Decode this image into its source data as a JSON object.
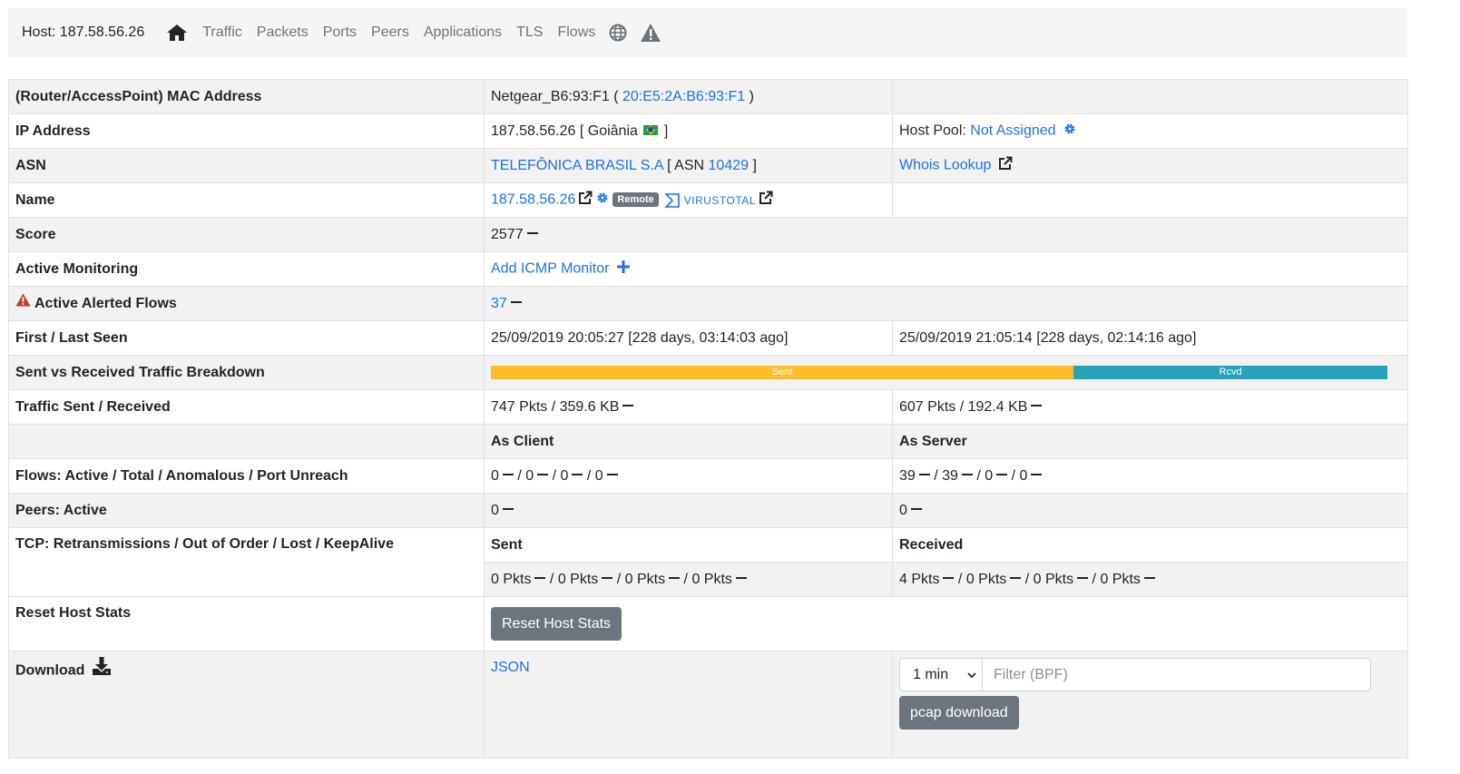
{
  "nav": {
    "host": "Host: 187.58.56.26",
    "items": [
      "Traffic",
      "Packets",
      "Ports",
      "Peers",
      "Applications",
      "TLS",
      "Flows"
    ]
  },
  "colors": {
    "link": "#1a73e8",
    "sent": "#fbbd2c",
    "rcvd": "#27a2b8",
    "button": "#6c757d",
    "alert": "#c0392b"
  },
  "rows": {
    "mac": {
      "label": "(Router/AccessPoint) MAC Address",
      "vendor": "Netgear_B6:93:F1 (",
      "mac": "20:E5:2A:B6:93:F1",
      "close": ")"
    },
    "ip": {
      "label": "IP Address",
      "value": "187.58.56.26 [ Goiânia",
      "close": "]",
      "pool_label": "Host Pool:",
      "pool_value": "Not Assigned"
    },
    "asn": {
      "label": "ASN",
      "org": "TELEFÔNICA BRASIL S.A",
      "asn_prefix": "[ ASN",
      "asn": "10429",
      "close": "]",
      "whois": "Whois Lookup"
    },
    "name": {
      "label": "Name",
      "value": "187.58.56.26",
      "badge": "Remote",
      "virustotal": "VIRUSTOTAL"
    },
    "score": {
      "label": "Score",
      "value": "2577"
    },
    "monitoring": {
      "label": "Active Monitoring",
      "link": "Add ICMP Monitor"
    },
    "alerted": {
      "label": "Active Alerted Flows",
      "value": "37"
    },
    "seen": {
      "label": "First / Last Seen",
      "first": "25/09/2019 20:05:27 [228 days, 03:14:03 ago]",
      "last": "25/09/2019 21:05:14 [228 days, 02:14:16 ago]"
    },
    "breakdown": {
      "label": "Sent vs Received Traffic Breakdown",
      "sent_label": "Sent",
      "rcvd_label": "Rcvd",
      "sent_pct": 65
    },
    "traffic": {
      "label": "Traffic Sent / Received",
      "sent": "747 Pkts / 359.6 KB",
      "received": "607 Pkts / 192.4 KB"
    },
    "roles": {
      "client": "As Client",
      "server": "As Server"
    },
    "flows": {
      "label": "Flows: Active / Total / Anomalous / Port Unreach",
      "client": [
        "0",
        "0",
        "0",
        "0"
      ],
      "server": [
        "39",
        "39",
        "0",
        "0"
      ]
    },
    "peers": {
      "label": "Peers: Active",
      "client": "0",
      "server": "0"
    },
    "tcp": {
      "label": "TCP: Retransmissions / Out of Order / Lost / KeepAlive",
      "sent_header": "Sent",
      "received_header": "Received",
      "sent": [
        "0 Pkts",
        "0 Pkts",
        "0 Pkts",
        "0 Pkts"
      ],
      "received": [
        "4 Pkts",
        "0 Pkts",
        "0 Pkts",
        "0 Pkts"
      ]
    },
    "reset": {
      "label": "Reset Host Stats",
      "button": "Reset Host Stats"
    },
    "download": {
      "label": "Download",
      "json": "JSON",
      "interval": "1 min",
      "filter_placeholder": "Filter (BPF)",
      "pcap_button": "pcap download"
    }
  }
}
